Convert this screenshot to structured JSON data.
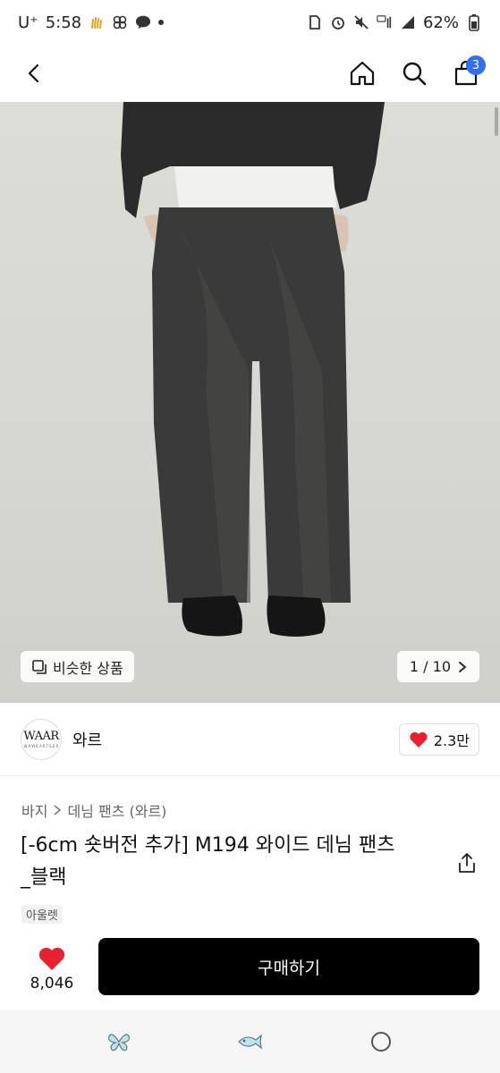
{
  "status_bar": {
    "carrier": "U⁺",
    "time": "5:58",
    "battery": "62%"
  },
  "top_nav": {
    "cart_count": "3"
  },
  "product_image": {
    "similar_label": "비슷한 상품",
    "page_counter": "1 / 10"
  },
  "brand": {
    "logo_text": "WAAR",
    "logo_subtext": "W.A.W.K.A.R.T.S.E.R",
    "name": "와르",
    "likes": "2.3만"
  },
  "product": {
    "breadcrumb": [
      "바지",
      "데님 팬츠 (와르)"
    ],
    "title_line1": "[-6cm 숏버전 추가] M194 와이드 데님 팬츠",
    "title_line2": "_블랙",
    "tag": "아울렛"
  },
  "buy_bar": {
    "wish_count": "8,046",
    "buy_label": "구매하기"
  },
  "colors": {
    "accent": "#2f6ff2",
    "heart": "#e8202f",
    "buy_button": "#000000"
  }
}
